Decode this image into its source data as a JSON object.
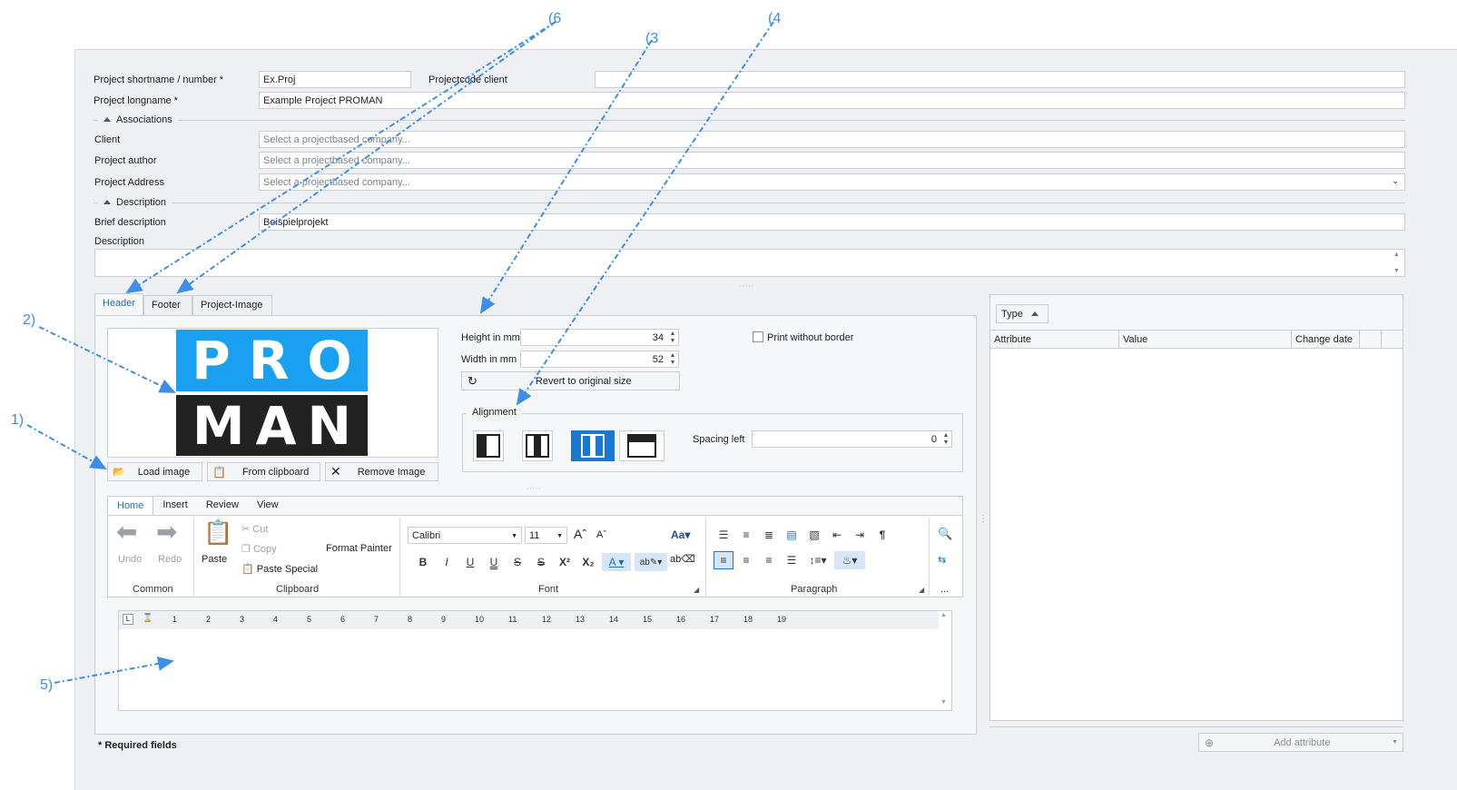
{
  "form": {
    "shortname_label": "Project shortname / number *",
    "shortname_value": "Ex.Proj",
    "projectcode_label": "Projectcode client",
    "projectcode_value": "",
    "longname_label": "Project longname *",
    "longname_value": "Example Project PROMAN"
  },
  "associations": {
    "title": "Associations",
    "client_label": "Client",
    "author_label": "Project author",
    "address_label": "Project Address",
    "placeholder": "Select a projectbased company..."
  },
  "description": {
    "title": "Description",
    "brief_label": "Brief description",
    "brief_value": "Beispielprojekt",
    "desc_label": "Description"
  },
  "tabs": [
    {
      "label": "Header"
    },
    {
      "label": "Footer"
    },
    {
      "label": "Project-Image"
    }
  ],
  "logo": {
    "line1": "PRO",
    "line2": "MAN",
    "top_color": "#1aa0f0",
    "bottom_color": "#222222"
  },
  "image_buttons": {
    "load": "Load image",
    "clipboard": "From clipboard",
    "remove": "Remove Image"
  },
  "size": {
    "height_label": "Height in mm",
    "height_value": "34",
    "width_label": "Width in mm",
    "width_value": "52",
    "revert": "Revert to original size",
    "print_without_border": "Print without border"
  },
  "alignment": {
    "title": "Alignment",
    "spacing_label": "Spacing left",
    "spacing_value": "0",
    "selected_index": 2
  },
  "ribbon": {
    "tabs": [
      "Home",
      "Insert",
      "Review",
      "View"
    ],
    "undo": "Undo",
    "redo": "Redo",
    "common": "Common",
    "paste": "Paste",
    "cut": "Cut",
    "copy": "Copy",
    "paste_special": "Paste Special",
    "format_painter": "Format Painter",
    "clipboard": "Clipboard",
    "font_name": "Calibri",
    "font_size": "11",
    "font": "Font",
    "paragraph": "Paragraph",
    "more": "..."
  },
  "ruler": {
    "marks": [
      "1",
      "2",
      "3",
      "4",
      "5",
      "6",
      "7",
      "8",
      "9",
      "10",
      "11",
      "12",
      "13",
      "14",
      "15",
      "16",
      "17",
      "18",
      "19"
    ]
  },
  "attributes": {
    "type_button": "Type",
    "columns": [
      "Attribute",
      "Value",
      "Change date"
    ],
    "add_button": "Add attribute"
  },
  "footer": {
    "required": "* Required fields"
  },
  "annotations": {
    "a1": "1)",
    "a2": "2)",
    "a3": "(3",
    "a4": "(4",
    "a5": "5)",
    "a6": "(6"
  },
  "colors": {
    "accent": "#1877d2",
    "annotation": "#3d8ee6"
  }
}
